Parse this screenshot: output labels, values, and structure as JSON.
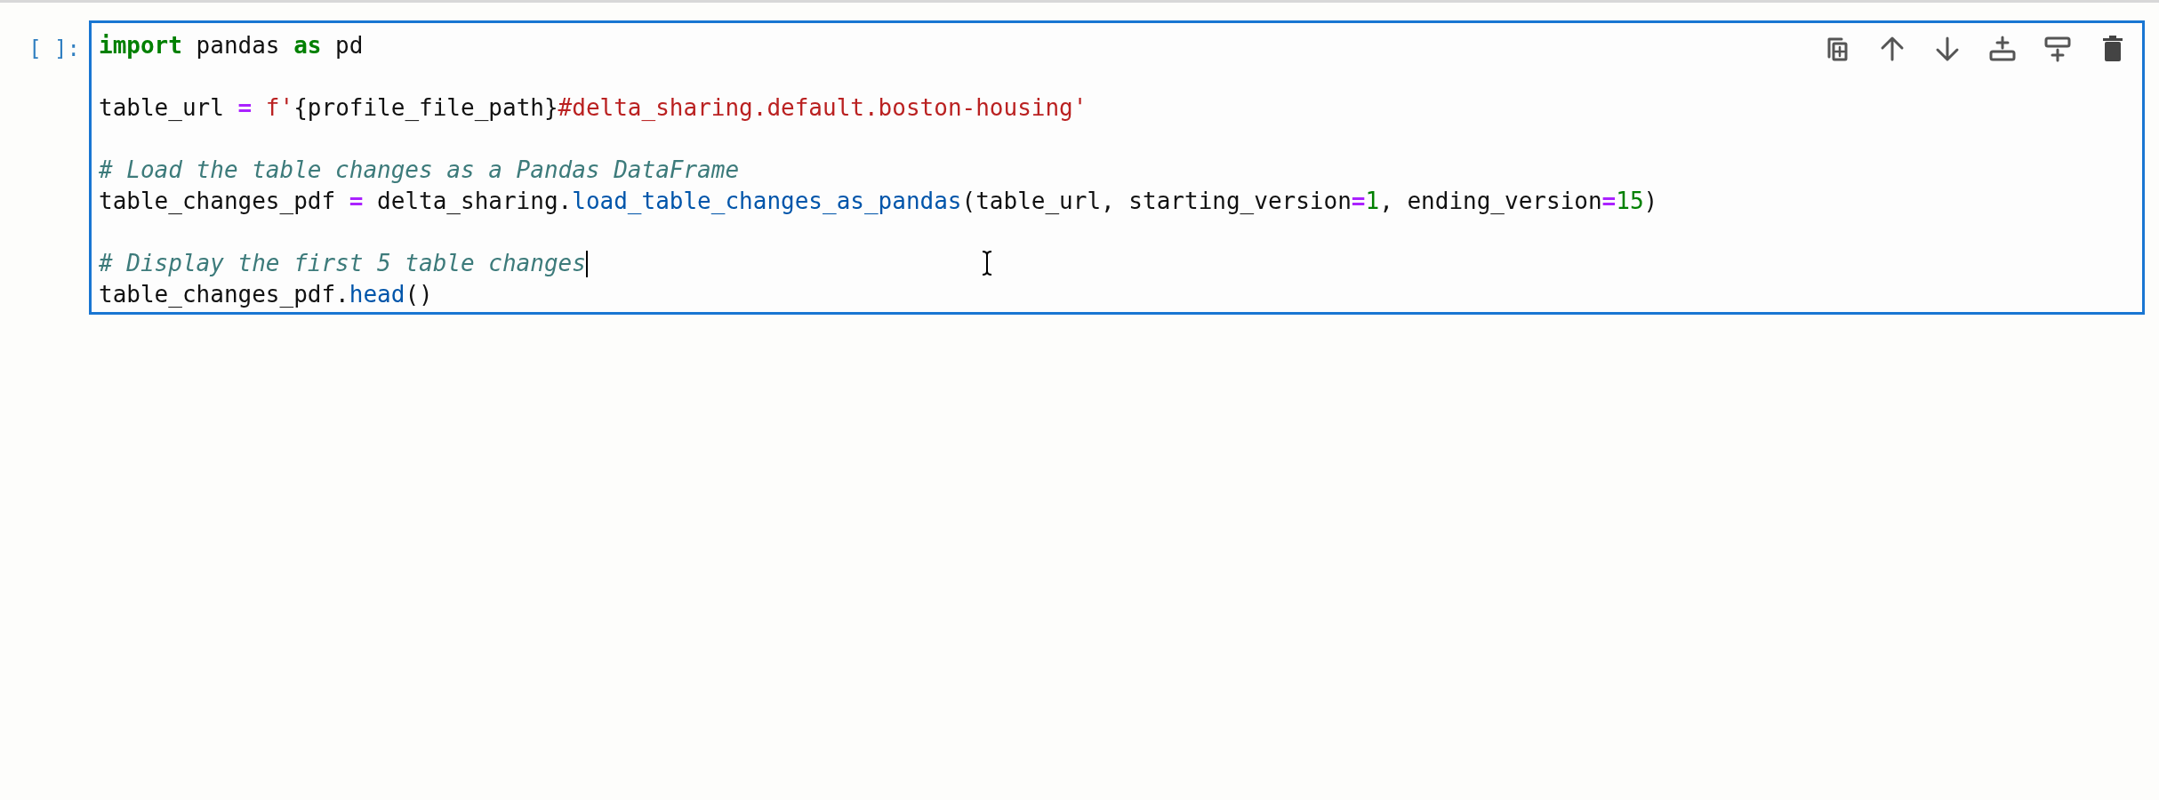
{
  "cell": {
    "prompt": "[ ]:",
    "active": true,
    "toolbar": [
      {
        "kind": "duplicate"
      },
      {
        "kind": "move-up"
      },
      {
        "kind": "move-down"
      },
      {
        "kind": "insert-above"
      },
      {
        "kind": "insert-below"
      },
      {
        "kind": "delete"
      }
    ],
    "lines": [
      {
        "kind": "code",
        "tokens": [
          {
            "kind": "keyword",
            "text": "import"
          },
          {
            "kind": "plain",
            "text": " pandas "
          },
          {
            "kind": "keyword",
            "text": "as"
          },
          {
            "kind": "plain",
            "text": " pd"
          }
        ]
      },
      {
        "kind": "blank"
      },
      {
        "kind": "code",
        "tokens": [
          {
            "kind": "plain",
            "text": "table_url "
          },
          {
            "kind": "operator",
            "text": "="
          },
          {
            "kind": "string",
            "text": " f'"
          },
          {
            "kind": "plain",
            "text": "{profile_file_path}"
          },
          {
            "kind": "string",
            "text": "#delta_sharing.default.boston-housing'"
          }
        ]
      },
      {
        "kind": "blank"
      },
      {
        "kind": "code",
        "tokens": [
          {
            "kind": "comment",
            "text": "# Load the table changes as a Pandas DataFrame"
          }
        ]
      },
      {
        "kind": "code",
        "tokens": [
          {
            "kind": "plain",
            "text": "table_changes_pdf "
          },
          {
            "kind": "operator",
            "text": "="
          },
          {
            "kind": "plain",
            "text": " delta_sharing."
          },
          {
            "kind": "function",
            "text": "load_table_changes_as_pandas"
          },
          {
            "kind": "plain",
            "text": "(table_url, starting_version"
          },
          {
            "kind": "operator",
            "text": "="
          },
          {
            "kind": "number",
            "text": "1"
          },
          {
            "kind": "plain",
            "text": ", ending_version"
          },
          {
            "kind": "operator",
            "text": "="
          },
          {
            "kind": "number",
            "text": "15"
          },
          {
            "kind": "plain",
            "text": ")"
          }
        ]
      },
      {
        "kind": "blank"
      },
      {
        "kind": "code",
        "caret": true,
        "tokens": [
          {
            "kind": "comment",
            "text": "# Display the first 5 table changes"
          }
        ]
      },
      {
        "kind": "code",
        "tokens": [
          {
            "kind": "plain",
            "text": "table_changes_pdf."
          },
          {
            "kind": "function",
            "text": "head"
          },
          {
            "kind": "plain",
            "text": "()"
          }
        ]
      }
    ]
  }
}
